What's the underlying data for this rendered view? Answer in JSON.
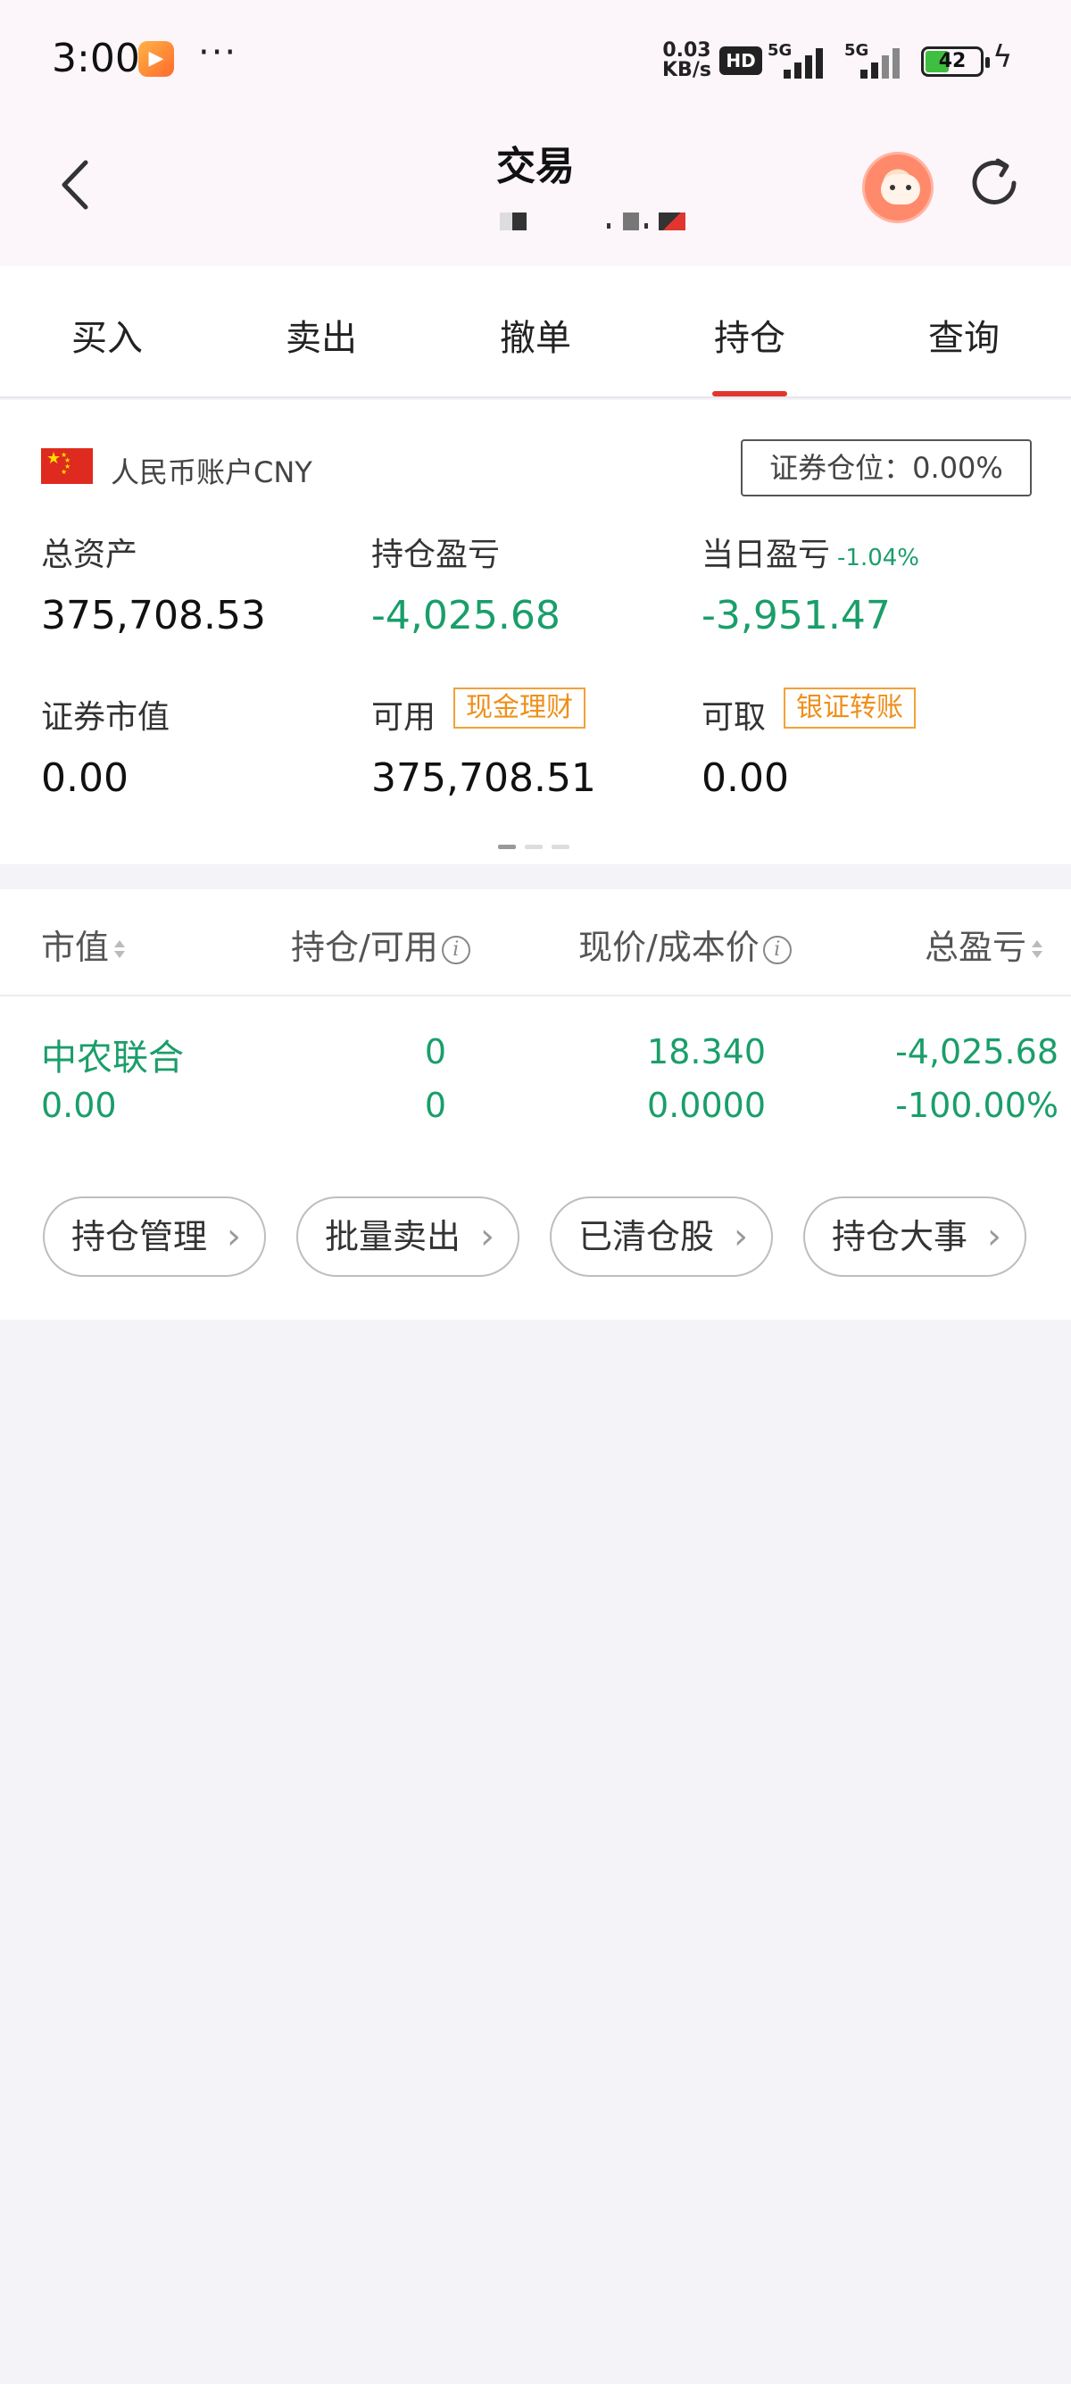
{
  "status_bar": {
    "time": "3:00",
    "app_icon": "app-badge-icon",
    "more": "···",
    "net_speed_value": "0.03",
    "net_speed_unit": "KB/s",
    "hd": "HD",
    "signal1_label": "5G",
    "signal2_label": "5G",
    "battery": "42",
    "charging_icon": "bolt-icon"
  },
  "header": {
    "title": "交易",
    "back_icon": "chevron-left-icon",
    "refresh_icon": "refresh-icon",
    "avatar_icon": "mascot-avatar-icon"
  },
  "tabs": [
    {
      "label": "买入"
    },
    {
      "label": "卖出"
    },
    {
      "label": "撤单"
    },
    {
      "label": "持仓",
      "active": true
    },
    {
      "label": "查询"
    }
  ],
  "account": {
    "currency_label": "人民币账户CNY",
    "position_ratio": "证券仓位：0.00%",
    "total_assets_label": "总资产",
    "total_assets": "375,708.53",
    "holding_pnl_label": "持仓盈亏",
    "holding_pnl": "-4,025.68",
    "daily_pnl_label": "当日盈亏",
    "daily_pnl_pct": "-1.04%",
    "daily_pnl": "-3,951.47",
    "market_value_label": "证券市值",
    "market_value": "0.00",
    "available_label": "可用",
    "cash_mgmt_btn": "现金理财",
    "available": "375,708.51",
    "withdrawable_label": "可取",
    "transfer_btn": "银证转账",
    "withdrawable": "0.00"
  },
  "holdings": {
    "columns": [
      "市值",
      "持仓/可用",
      "现价/成本价",
      "总盈亏"
    ],
    "rows": [
      {
        "name": "中农联合",
        "market_value": "0.00",
        "position": "0",
        "available": "0",
        "price": "18.340",
        "cost": "0.0000",
        "total_pnl": "-4,025.68",
        "total_pnl_pct": "-100.00%"
      }
    ],
    "actions": [
      "持仓管理",
      "批量卖出",
      "已清仓股",
      "持仓大事"
    ]
  },
  "colors": {
    "accent_red": "#e2352f",
    "loss_green": "#1a9e6a",
    "tag_orange": "#ef8f1a"
  }
}
